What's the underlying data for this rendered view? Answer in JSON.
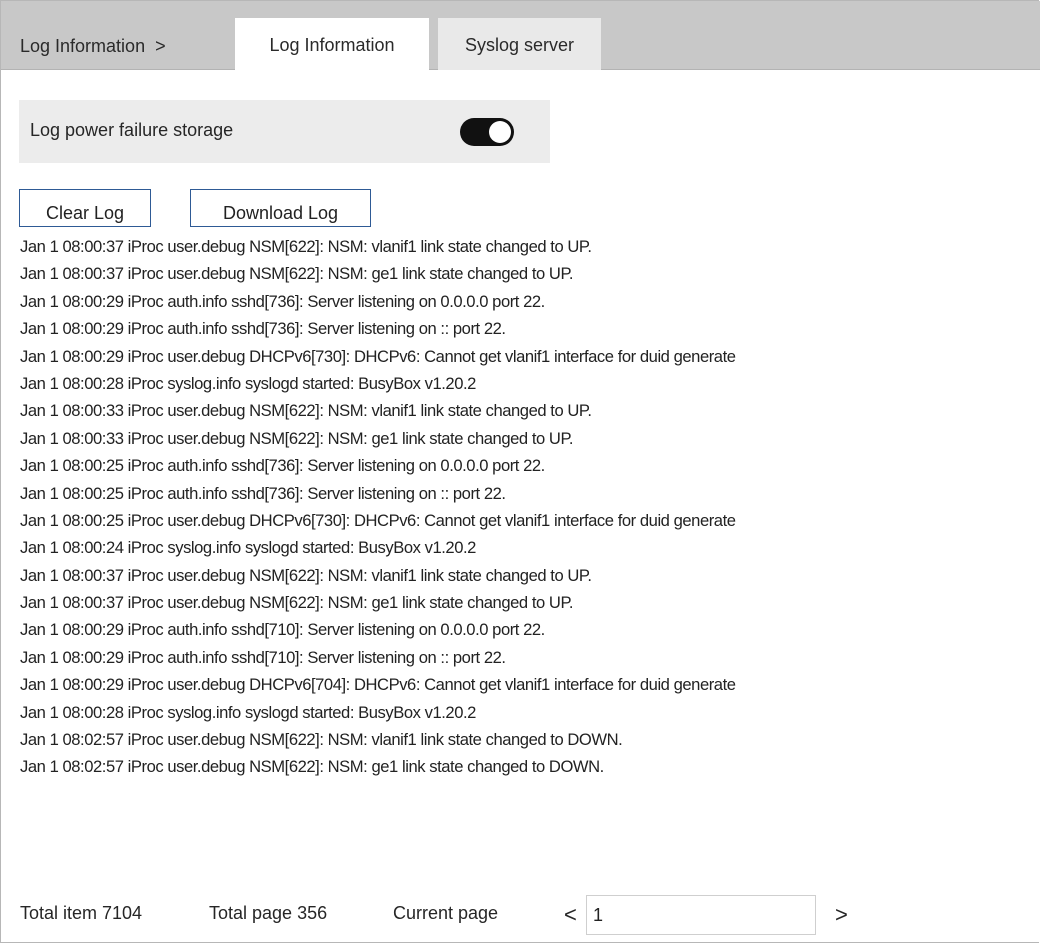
{
  "header": {
    "breadcrumb_label": "Log Information",
    "breadcrumb_separator": ">",
    "tabs": [
      {
        "label": "Log Information",
        "active": true
      },
      {
        "label": "Syslog server",
        "active": false
      }
    ]
  },
  "power_failure": {
    "label": "Log power failure storage",
    "enabled": true
  },
  "actions": {
    "clear_label": "Clear Log",
    "download_label": "Download Log"
  },
  "logs": [
    "Jan 1 08:00:37 iProc user.debug NSM[622]: NSM: vlanif1 link state changed to UP.",
    "Jan 1 08:00:37 iProc user.debug NSM[622]: NSM: ge1 link state changed to UP.",
    "Jan 1 08:00:29 iProc auth.info sshd[736]: Server listening on 0.0.0.0 port 22.",
    "Jan 1 08:00:29 iProc auth.info sshd[736]: Server listening on :: port 22.",
    "Jan 1 08:00:29 iProc user.debug DHCPv6[730]: DHCPv6: Cannot get vlanif1 interface for duid generate",
    "Jan 1 08:00:28 iProc syslog.info syslogd started: BusyBox v1.20.2",
    "Jan 1 08:00:33 iProc user.debug NSM[622]: NSM: vlanif1 link state changed to UP.",
    "Jan 1 08:00:33 iProc user.debug NSM[622]: NSM: ge1 link state changed to UP.",
    "Jan 1 08:00:25 iProc auth.info sshd[736]: Server listening on 0.0.0.0 port 22.",
    "Jan 1 08:00:25 iProc auth.info sshd[736]: Server listening on :: port 22.",
    "Jan 1 08:00:25 iProc user.debug DHCPv6[730]: DHCPv6: Cannot get vlanif1 interface for duid generate",
    "Jan 1 08:00:24 iProc syslog.info syslogd started: BusyBox v1.20.2",
    "Jan 1 08:00:37 iProc user.debug NSM[622]: NSM: vlanif1 link state changed to UP.",
    "Jan 1 08:00:37 iProc user.debug NSM[622]: NSM: ge1 link state changed to UP.",
    "Jan 1 08:00:29 iProc auth.info sshd[710]: Server listening on 0.0.0.0 port 22.",
    "Jan 1 08:00:29 iProc auth.info sshd[710]: Server listening on :: port 22.",
    "Jan 1 08:00:29 iProc user.debug DHCPv6[704]: DHCPv6: Cannot get vlanif1 interface for duid generate",
    "Jan 1 08:00:28 iProc syslog.info syslogd started: BusyBox v1.20.2",
    "Jan 1 08:02:57 iProc user.debug NSM[622]: NSM: vlanif1 link state changed to DOWN.",
    "Jan 1 08:02:57 iProc user.debug NSM[622]: NSM: ge1 link state changed to DOWN."
  ],
  "pagination": {
    "total_items_text": "Total item 7104",
    "total_pages_text": "Total page 356",
    "current_page_label": "Current page",
    "current_page_value": "1",
    "prev_icon": "chevron-left-icon",
    "next_icon": "chevron-right-icon",
    "prev_glyph": "<",
    "next_glyph": ">"
  },
  "colors": {
    "tab_bar": "#c8c8c8",
    "active_tab": "#ffffff",
    "inactive_tab": "#e9e9e9",
    "panel": "#ececec",
    "button_border": "#2e5a95",
    "toggle_on": "#111111"
  }
}
